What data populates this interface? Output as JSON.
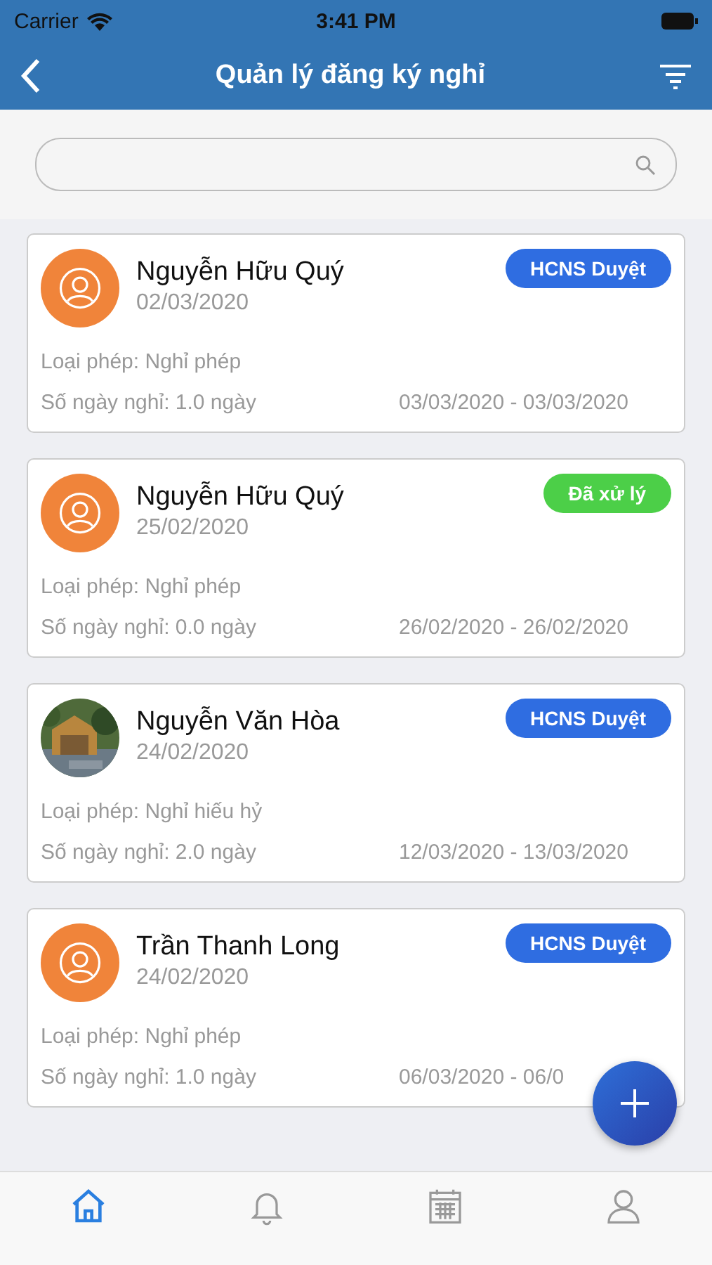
{
  "status_bar": {
    "carrier": "Carrier",
    "time": "3:41 PM"
  },
  "nav": {
    "title": "Quản lý đăng ký nghỉ"
  },
  "requests": [
    {
      "name": "Nguyễn Hữu Quý",
      "date": "02/03/2020",
      "status": "HCNS Duyệt",
      "color": "#2f6de1",
      "avatar": {
        "kind": "placeholder"
      },
      "leave_type": "Loại phép: Nghỉ phép",
      "days": "Số ngày nghỉ: 1.0 ngày",
      "range": "03/03/2020 - 03/03/2020"
    },
    {
      "name": "Nguyễn Hữu Quý",
      "date": "25/02/2020",
      "status": "Đã xử lý",
      "color": "#4ccf48",
      "avatar": {
        "kind": "placeholder"
      },
      "leave_type": "Loại phép: Nghỉ phép",
      "days": "Số ngày nghỉ: 0.0 ngày",
      "range": "26/02/2020 - 26/02/2020"
    },
    {
      "name": "Nguyễn Văn Hòa",
      "date": "24/02/2020",
      "status": "HCNS Duyệt",
      "color": "#2f6de1",
      "leave_type": "Loại phép: Nghỉ hiếu hỷ",
      "days": "Số ngày nghỉ: 2.0 ngày",
      "range": "12/03/2020 - 13/03/2020"
    },
    {
      "name": "Trần Thanh Long",
      "date": "24/02/2020",
      "status": "HCNS Duyệt",
      "color": "#2f6de1",
      "avatar": {
        "kind": "placeholder"
      },
      "leave_type": "Loại phép: Nghỉ phép",
      "days": "Số ngày nghỉ: 1.0 ngày",
      "range": "06/03/2020 - 06/0"
    }
  ],
  "tabs": [
    {
      "kind": "home",
      "selected": true
    },
    {
      "kind": "bell",
      "selected": false
    },
    {
      "kind": "calendar",
      "selected": false
    },
    {
      "kind": "user",
      "selected": false
    }
  ]
}
